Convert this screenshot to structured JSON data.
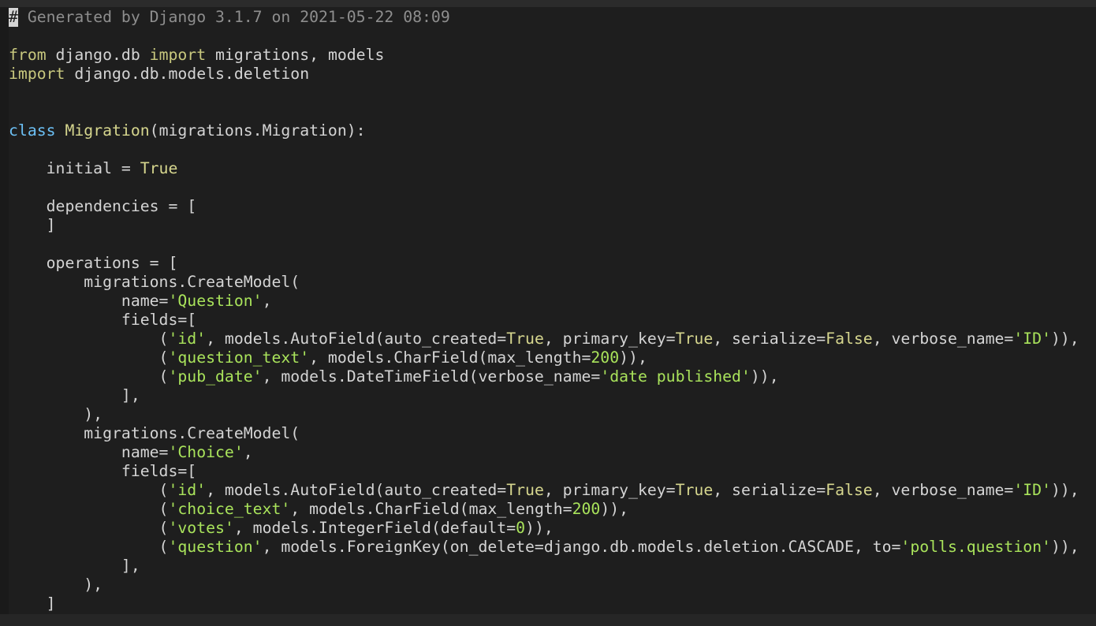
{
  "editor": {
    "lines": [
      [
        {
          "t": "#",
          "c": "cursor"
        },
        {
          "t": " Generated by Django 3.1.7 on 2021-05-22 08:09",
          "c": "cm"
        }
      ],
      [],
      [
        {
          "t": "from",
          "c": "kw"
        },
        {
          "t": " django.db "
        },
        {
          "t": "import",
          "c": "kw"
        },
        {
          "t": " migrations, models"
        }
      ],
      [
        {
          "t": "import",
          "c": "kw"
        },
        {
          "t": " django.db.models.deletion"
        }
      ],
      [],
      [],
      [
        {
          "t": "class",
          "c": "kwc"
        },
        {
          "t": " "
        },
        {
          "t": "Migration",
          "c": "cls"
        },
        {
          "t": "(migrations.Migration):"
        }
      ],
      [],
      [
        {
          "t": "    initial = "
        },
        {
          "t": "True",
          "c": "bool"
        }
      ],
      [],
      [
        {
          "t": "    dependencies = ["
        }
      ],
      [
        {
          "t": "    ]"
        }
      ],
      [],
      [
        {
          "t": "    operations = ["
        }
      ],
      [
        {
          "t": "        migrations.CreateModel("
        }
      ],
      [
        {
          "t": "            name="
        },
        {
          "t": "'Question'",
          "c": "str"
        },
        {
          "t": ","
        }
      ],
      [
        {
          "t": "            fields=["
        }
      ],
      [
        {
          "t": "                ("
        },
        {
          "t": "'id'",
          "c": "str"
        },
        {
          "t": ", models.AutoField(auto_created="
        },
        {
          "t": "True",
          "c": "bool"
        },
        {
          "t": ", primary_key="
        },
        {
          "t": "True",
          "c": "bool"
        },
        {
          "t": ", serialize="
        },
        {
          "t": "False",
          "c": "bool"
        },
        {
          "t": ", verbose_name="
        },
        {
          "t": "'ID'",
          "c": "str"
        },
        {
          "t": ")),"
        }
      ],
      [
        {
          "t": "                ("
        },
        {
          "t": "'question_text'",
          "c": "str"
        },
        {
          "t": ", models.CharField(max_length="
        },
        {
          "t": "200",
          "c": "num"
        },
        {
          "t": ")),"
        }
      ],
      [
        {
          "t": "                ("
        },
        {
          "t": "'pub_date'",
          "c": "str"
        },
        {
          "t": ", models.DateTimeField(verbose_name="
        },
        {
          "t": "'date published'",
          "c": "str"
        },
        {
          "t": ")),"
        }
      ],
      [
        {
          "t": "            ],"
        }
      ],
      [
        {
          "t": "        ),"
        }
      ],
      [
        {
          "t": "        migrations.CreateModel("
        }
      ],
      [
        {
          "t": "            name="
        },
        {
          "t": "'Choice'",
          "c": "str"
        },
        {
          "t": ","
        }
      ],
      [
        {
          "t": "            fields=["
        }
      ],
      [
        {
          "t": "                ("
        },
        {
          "t": "'id'",
          "c": "str"
        },
        {
          "t": ", models.AutoField(auto_created="
        },
        {
          "t": "True",
          "c": "bool"
        },
        {
          "t": ", primary_key="
        },
        {
          "t": "True",
          "c": "bool"
        },
        {
          "t": ", serialize="
        },
        {
          "t": "False",
          "c": "bool"
        },
        {
          "t": ", verbose_name="
        },
        {
          "t": "'ID'",
          "c": "str"
        },
        {
          "t": ")),"
        }
      ],
      [
        {
          "t": "                ("
        },
        {
          "t": "'choice_text'",
          "c": "str"
        },
        {
          "t": ", models.CharField(max_length="
        },
        {
          "t": "200",
          "c": "num"
        },
        {
          "t": ")),"
        }
      ],
      [
        {
          "t": "                ("
        },
        {
          "t": "'votes'",
          "c": "str"
        },
        {
          "t": ", models.IntegerField(default="
        },
        {
          "t": "0",
          "c": "num"
        },
        {
          "t": ")),"
        }
      ],
      [
        {
          "t": "                ("
        },
        {
          "t": "'question'",
          "c": "str"
        },
        {
          "t": ", models.ForeignKey(on_delete=django.db.models.deletion.CASCADE, to="
        },
        {
          "t": "'polls.question'",
          "c": "str"
        },
        {
          "t": ")),"
        }
      ],
      [
        {
          "t": "            ],"
        }
      ],
      [
        {
          "t": "        ),"
        }
      ],
      [
        {
          "t": "    ]"
        }
      ]
    ]
  },
  "colors": {
    "background": "#1e1e1e",
    "text": "#d4d4d4",
    "comment": "#8e8e8e",
    "keyword": "#c8c87e",
    "class_keyword": "#6cc0f5",
    "string": "#a9e35b",
    "boolean": "#d6d68e"
  }
}
